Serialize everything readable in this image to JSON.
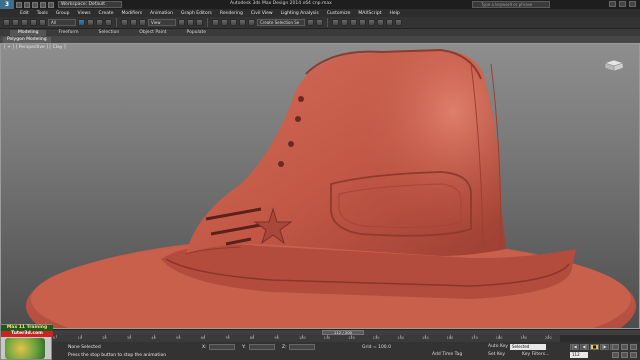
{
  "app": {
    "title": "Autodesk 3ds Max Design 2014 x64     cnp.max",
    "workspace": "Workspace: Default",
    "search_placeholder": "Type a keyword or phrase",
    "logo": "3"
  },
  "menu": [
    "Edit",
    "Tools",
    "Group",
    "Views",
    "Create",
    "Modifiers",
    "Animation",
    "Graph Editors",
    "Rendering",
    "Civil View",
    "Lighting Analysis",
    "Customize",
    "MAXScript",
    "Help"
  ],
  "toolbar": {
    "selection_filter": "All",
    "coord_system": "View",
    "named_selection": "Create Selection Se"
  },
  "ribbon": {
    "tabs": [
      "Modeling",
      "Freeform",
      "Selection",
      "Object Paint",
      "Populate"
    ],
    "active_tab": "Modeling",
    "subtab": "Polygon Modeling"
  },
  "viewport": {
    "label": "[ + ] [ Perspective ] [ Clay ]"
  },
  "timeline": {
    "frame_counter": "112 / 200",
    "ticks": [
      "0",
      "10",
      "20",
      "30",
      "40",
      "50",
      "60",
      "70",
      "80",
      "90",
      "100",
      "110",
      "120",
      "130",
      "140",
      "150",
      "160",
      "170",
      "180",
      "190",
      "200"
    ]
  },
  "status": {
    "selection_text": "None Selected",
    "prompt": "Press the stop button to stop the animation",
    "x_label": "X:",
    "y_label": "Y:",
    "z_label": "Z:",
    "grid": "Grid = 100.0",
    "add_time_tag": "Add Time Tag",
    "auto_key": "Auto Key",
    "set_key": "Set Key",
    "selected_mode": "Selected",
    "key_filters": "Key Filters...",
    "current_frame": "112"
  },
  "playback": {
    "buttons": [
      "|◀",
      "◀|",
      "■",
      "|▶",
      "▶|"
    ]
  },
  "watermark": {
    "line1": "Max 11 Training",
    "line2": "Tuter3d.com"
  },
  "colors": {
    "shoe_clay": "#c65a48",
    "viewport_bg_top": "#8e8e8e",
    "play_button": "#e6d23a"
  }
}
